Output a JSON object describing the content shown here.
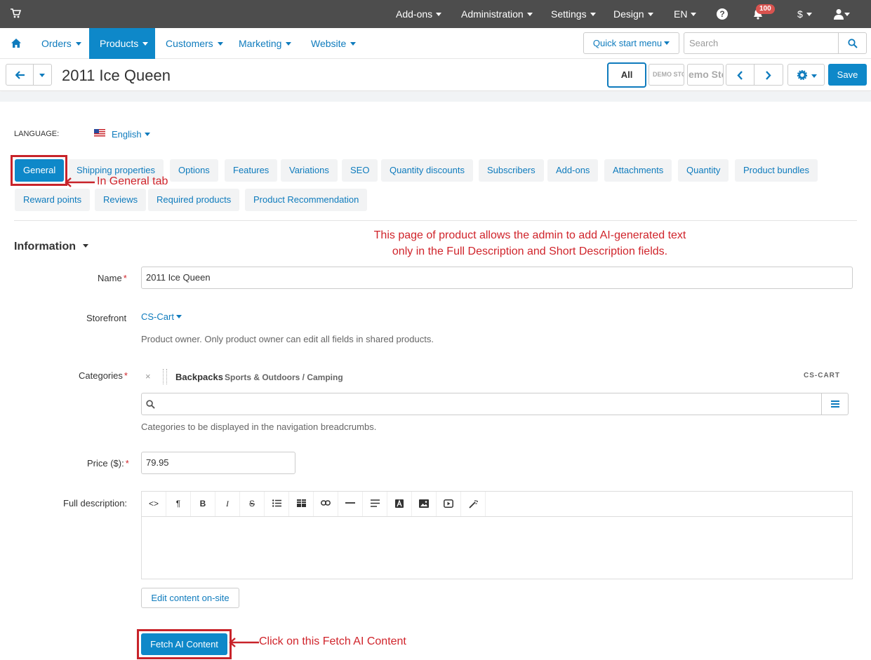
{
  "topbar": {
    "menu": [
      "Add-ons",
      "Administration",
      "Settings",
      "Design",
      "EN",
      "$"
    ],
    "notification_count": "100",
    "icons": [
      "cart-icon",
      "help-icon",
      "bell-icon",
      "user-icon"
    ]
  },
  "navbar": {
    "items": [
      "Orders",
      "Products",
      "Customers",
      "Marketing",
      "Website"
    ],
    "active": "Products",
    "quick_start": "Quick start menu",
    "search_placeholder": "Search"
  },
  "titlebar": {
    "title": "2011 Ice Queen",
    "all": "All",
    "demo_1": "DEMO STO",
    "demo_2": "emo Sto",
    "save": "Save"
  },
  "language": {
    "label": "LANGUAGE:",
    "value": "English"
  },
  "tabs": {
    "row1": [
      "General",
      "Shipping properties",
      "Options",
      "Features",
      "Variations",
      "SEO",
      "Quantity discounts",
      "Subscribers",
      "Add-ons",
      "Attachments",
      "Quantity",
      "Product bundles"
    ],
    "row2": [
      "Reward points",
      "Reviews",
      "Required products",
      "Product Recommendation"
    ],
    "active": "General"
  },
  "annotations": {
    "general_tab": "In General tab",
    "note_line1": "This page of product allows the admin to add AI-generated text",
    "note_line2": "only in the Full Description and Short Description fields.",
    "fetch": "Click on this Fetch AI Content"
  },
  "form": {
    "section": "Information",
    "name_label": "Name",
    "name_value": "2011 Ice Queen",
    "storefront_label": "Storefront",
    "storefront_value": "CS-Cart",
    "storefront_help": "Product owner. Only product owner can edit all fields in shared products.",
    "categories_label": "Categories",
    "category_x": "×",
    "category_name": "Backpacks",
    "category_path": "Sports & Outdoors / Camping",
    "category_owner": "CS-CART",
    "categories_help": "Categories to be displayed in the navigation breadcrumbs.",
    "price_label": "Price ($):",
    "price_value": "79.95",
    "full_desc_label": "Full description:",
    "edit_onsite": "Edit content on-site",
    "fetch_ai": "Fetch AI Content"
  },
  "colors": {
    "accent": "#0e88c9",
    "link": "#0e7bbd",
    "topbar": "#4d4d4d",
    "annotation": "#d0242b"
  }
}
